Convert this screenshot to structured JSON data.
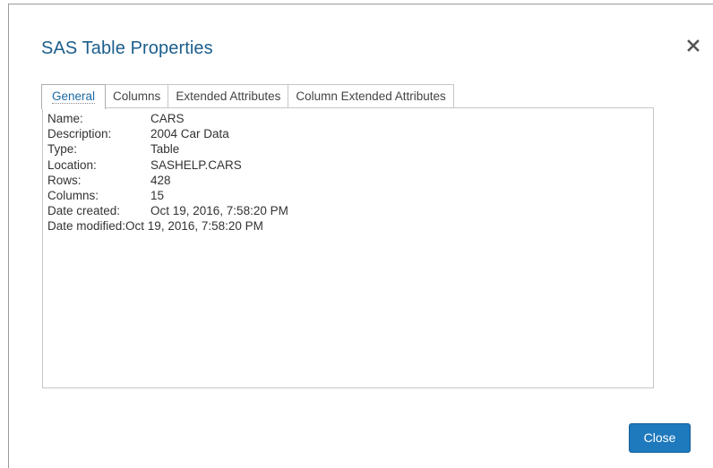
{
  "dialog": {
    "title": "SAS Table Properties",
    "close_icon": "close-icon"
  },
  "tabs": [
    {
      "label": "General",
      "active": true
    },
    {
      "label": "Columns",
      "active": false
    },
    {
      "label": "Extended Attributes",
      "active": false
    },
    {
      "label": "Column Extended Attributes",
      "active": false
    }
  ],
  "properties": [
    {
      "label": "Name:",
      "value": "CARS"
    },
    {
      "label": "Description:",
      "value": "2004 Car Data"
    },
    {
      "label": "Type:",
      "value": "Table"
    },
    {
      "label": "Location:",
      "value": "SASHELP.CARS"
    },
    {
      "label": "Rows:",
      "value": "428"
    },
    {
      "label": "Columns:",
      "value": "15"
    },
    {
      "label": "Date created:",
      "value": "Oct 19, 2016, 7:58:20 PM"
    },
    {
      "label": "Date modified:",
      "value": "Oct 19, 2016, 7:58:20 PM"
    }
  ],
  "footer": {
    "close_label": "Close"
  },
  "colors": {
    "title": "#1b5e8c",
    "accent_button": "#1e79bd",
    "active_tab_text": "#1d6aa5"
  }
}
